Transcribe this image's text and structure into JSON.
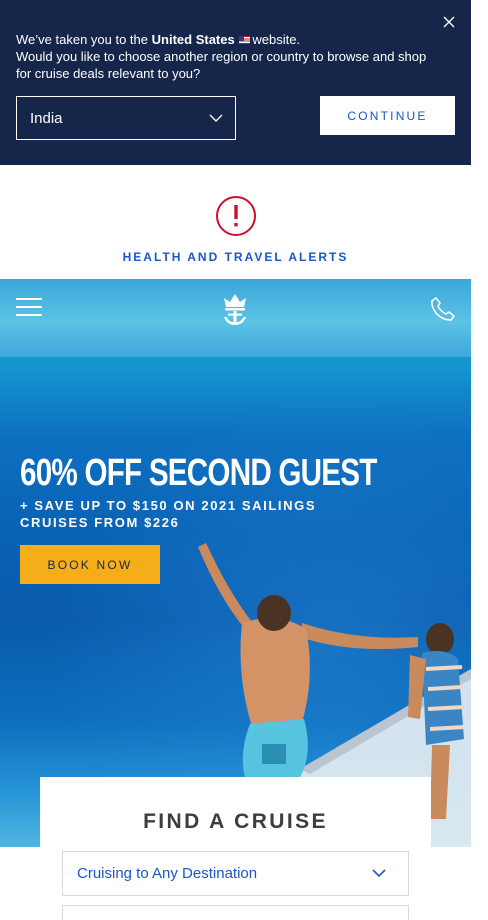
{
  "region_banner": {
    "message_prefix": "We’ve taken you to the",
    "country": "United States",
    "message_suffix": "website.",
    "question": "Would you like to choose another region or country to browse and shop for cruise deals relevant to you?",
    "selected_region": "India",
    "continue_label": "CONTINUE"
  },
  "alerts": {
    "icon_glyph": "!",
    "link_label": "HEALTH AND TRAVEL ALERTS"
  },
  "hero": {
    "promo_title": "60% OFF SECOND GUEST",
    "promo_line1": "+ SAVE UP TO $150 ON 2021 SAILINGS",
    "promo_line2": "CRUISES FROM $226",
    "book_label": "BOOK NOW"
  },
  "find_cruise": {
    "title": "FIND A CRUISE",
    "destination_value": "Cruising to Any Destination"
  },
  "colors": {
    "banner_bg": "#15264a",
    "accent_blue": "#1a56c8",
    "alert_red": "#d0102a",
    "book_yellow": "#f5ae1a"
  },
  "icons": [
    "close-icon",
    "chevron-down-icon",
    "alert-icon",
    "menu-icon",
    "crown-anchor-logo",
    "phone-icon",
    "us-flag-icon"
  ]
}
